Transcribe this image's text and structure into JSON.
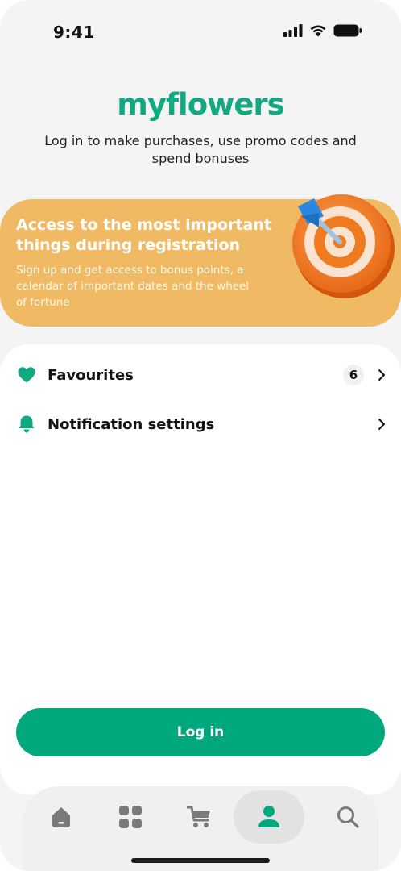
{
  "status_bar": {
    "time": "9:41"
  },
  "header": {
    "logo": "myflowers",
    "subtitle": "Log in to make purchases, use promo codes and spend bonuses"
  },
  "promo": {
    "title": "Access to the most important things during registration",
    "text": "Sign up and get access to bonus points, a calendar of important dates and the wheel of fortune"
  },
  "menu": {
    "items": [
      {
        "label": "Favourites",
        "icon": "heart-icon",
        "count": "6"
      },
      {
        "label": "Notification settings",
        "icon": "bell-icon"
      }
    ]
  },
  "login_button": {
    "label": "Log in"
  },
  "tabbar": {
    "tabs": [
      {
        "icon": "home-icon"
      },
      {
        "icon": "catalog-grid-icon"
      },
      {
        "icon": "cart-icon"
      },
      {
        "icon": "profile-icon",
        "active": true
      },
      {
        "icon": "search-icon"
      }
    ]
  },
  "colors": {
    "brand": "#12a882",
    "button": "#01a87e",
    "promo_bg": "#f0b964",
    "target_orange": "#f07a1e",
    "dart_blue": "#2a86e0"
  }
}
